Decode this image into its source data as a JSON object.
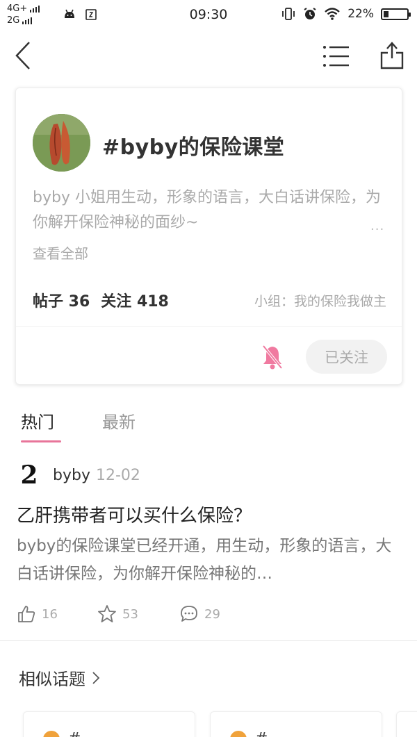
{
  "status_bar": {
    "network_top": "4G+",
    "network_bottom": "2G",
    "time": "09:30",
    "battery": "22%",
    "battery_level": 0.22
  },
  "nav": {
    "back_icon": "chevron-left-icon",
    "list_icon": "list-icon",
    "share_icon": "share-icon"
  },
  "topic": {
    "title": "#byby的保险课堂",
    "description": "byby 小姐用生动，形象的语言，大白话讲保险，为你解开保险神秘的面纱~",
    "ellipsis": "...",
    "view_all": "查看全部",
    "posts_label": "帖子 36",
    "followers_label": "关注 418",
    "group": "小组：我的保险我做主",
    "follow_button": "已关注",
    "colors": {
      "accent": "#e8759a"
    }
  },
  "tabs": [
    {
      "label": "热门",
      "active": true
    },
    {
      "label": "最新",
      "active": false
    }
  ],
  "post": {
    "author_avatar_glyph": "2",
    "author": "byby",
    "date": "12-02",
    "title": "乙肝携带者可以买什么保险？",
    "excerpt": "byby的保险课堂已经开通，用生动，形象的语言，大白话讲保险，为你解开保险神秘的…",
    "likes": "16",
    "favorites": "53",
    "comments": "29"
  },
  "similar": {
    "title": "相似话题",
    "items": [
      {
        "label": "#"
      },
      {
        "label": "#"
      },
      {
        "label": ""
      }
    ]
  }
}
